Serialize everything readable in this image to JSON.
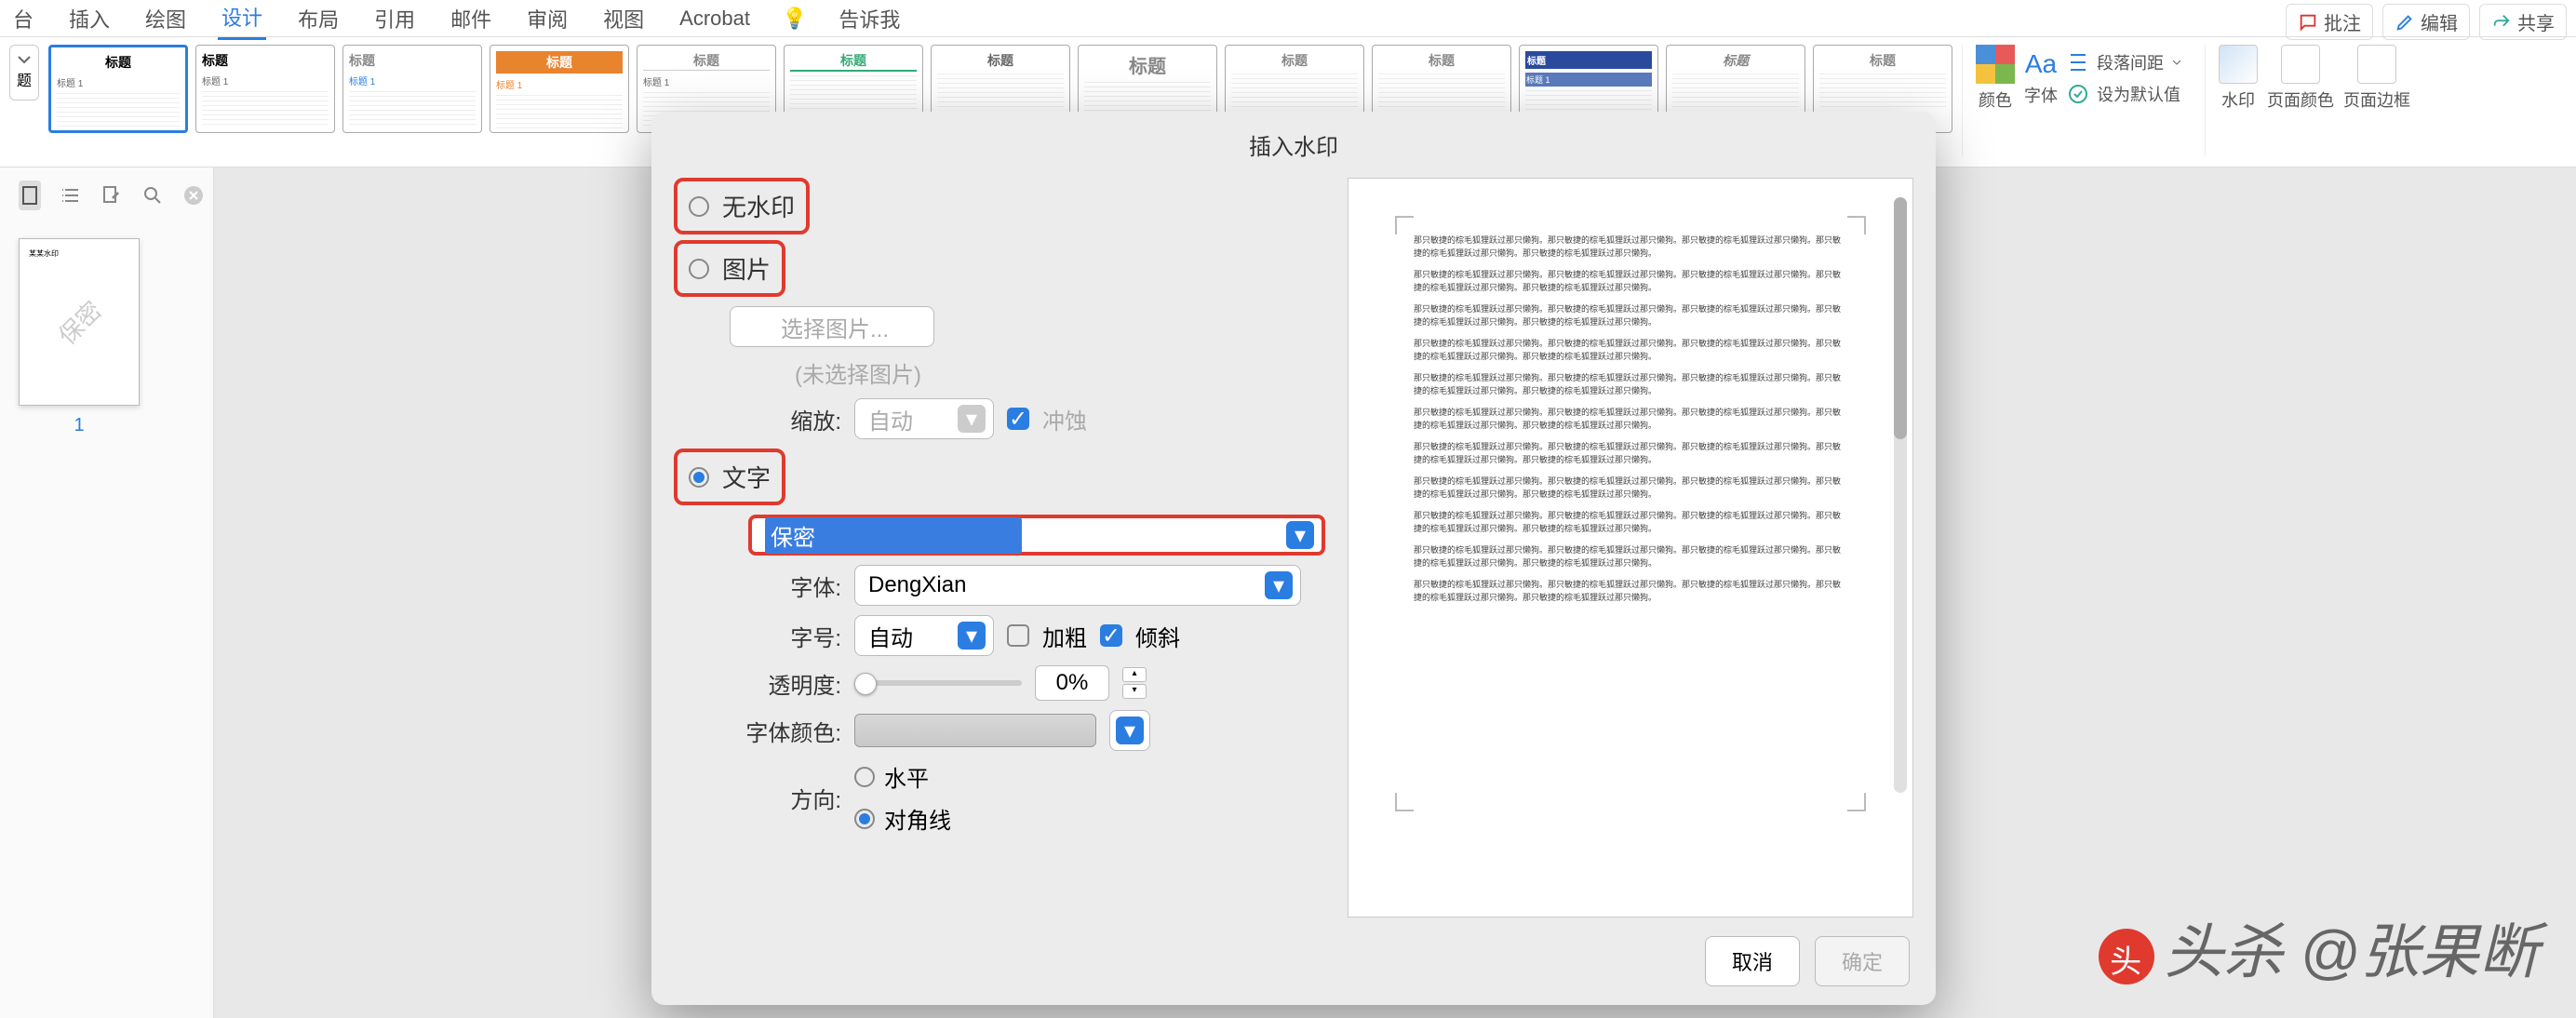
{
  "ribbon": {
    "tabs": [
      "台",
      "插入",
      "绘图",
      "设计",
      "布局",
      "引用",
      "邮件",
      "审阅",
      "视图",
      "Acrobat"
    ],
    "tell_me_icon": "💡",
    "tell_me": "告诉我",
    "active_tab": "设计",
    "right_buttons": {
      "comment": "批注",
      "edit": "编辑",
      "share": "共享"
    },
    "styles": {
      "card_title": "标题",
      "card_sub": "标题 1"
    },
    "groups": {
      "colors": "颜色",
      "fonts": "字体",
      "paragraph_spacing": "段落间距",
      "set_default": "设为默认值",
      "watermark": "水印",
      "page_color": "页面颜色",
      "page_border": "页面边框"
    }
  },
  "left_panel": {
    "page_number": "1",
    "thumb_watermark": "保密",
    "thumb_title": "某某水印"
  },
  "dialog": {
    "title": "插入水印",
    "options": {
      "none": "无水印",
      "picture": "图片",
      "text": "文字"
    },
    "picture": {
      "select_btn": "选择图片...",
      "status": "(未选择图片)",
      "scale_label": "缩放:",
      "scale_value": "自动",
      "washout": "冲蚀"
    },
    "text": {
      "value": "保密",
      "font_label": "字体:",
      "font_value": "DengXian",
      "size_label": "字号:",
      "size_value": "自动",
      "bold": "加粗",
      "italic": "倾斜",
      "opacity_label": "透明度:",
      "opacity_value": "0%",
      "color_label": "字体颜色:",
      "direction_label": "方向:",
      "direction_h": "水平",
      "direction_d": "对角线"
    },
    "footer": {
      "cancel": "取消",
      "ok": "确定"
    },
    "preview_line": "那只敏捷的棕毛狐狸跃过那只懒狗。那只敏捷的棕毛狐狸跃过那只懒狗。那只敏捷的棕毛狐狸跃过那只懒狗。那只敏捷的棕毛狐狸跃过那只懒狗。那只敏捷的棕毛狐狸跃过那只懒狗。"
  },
  "overlay": {
    "text": "头杀 @张果断"
  }
}
